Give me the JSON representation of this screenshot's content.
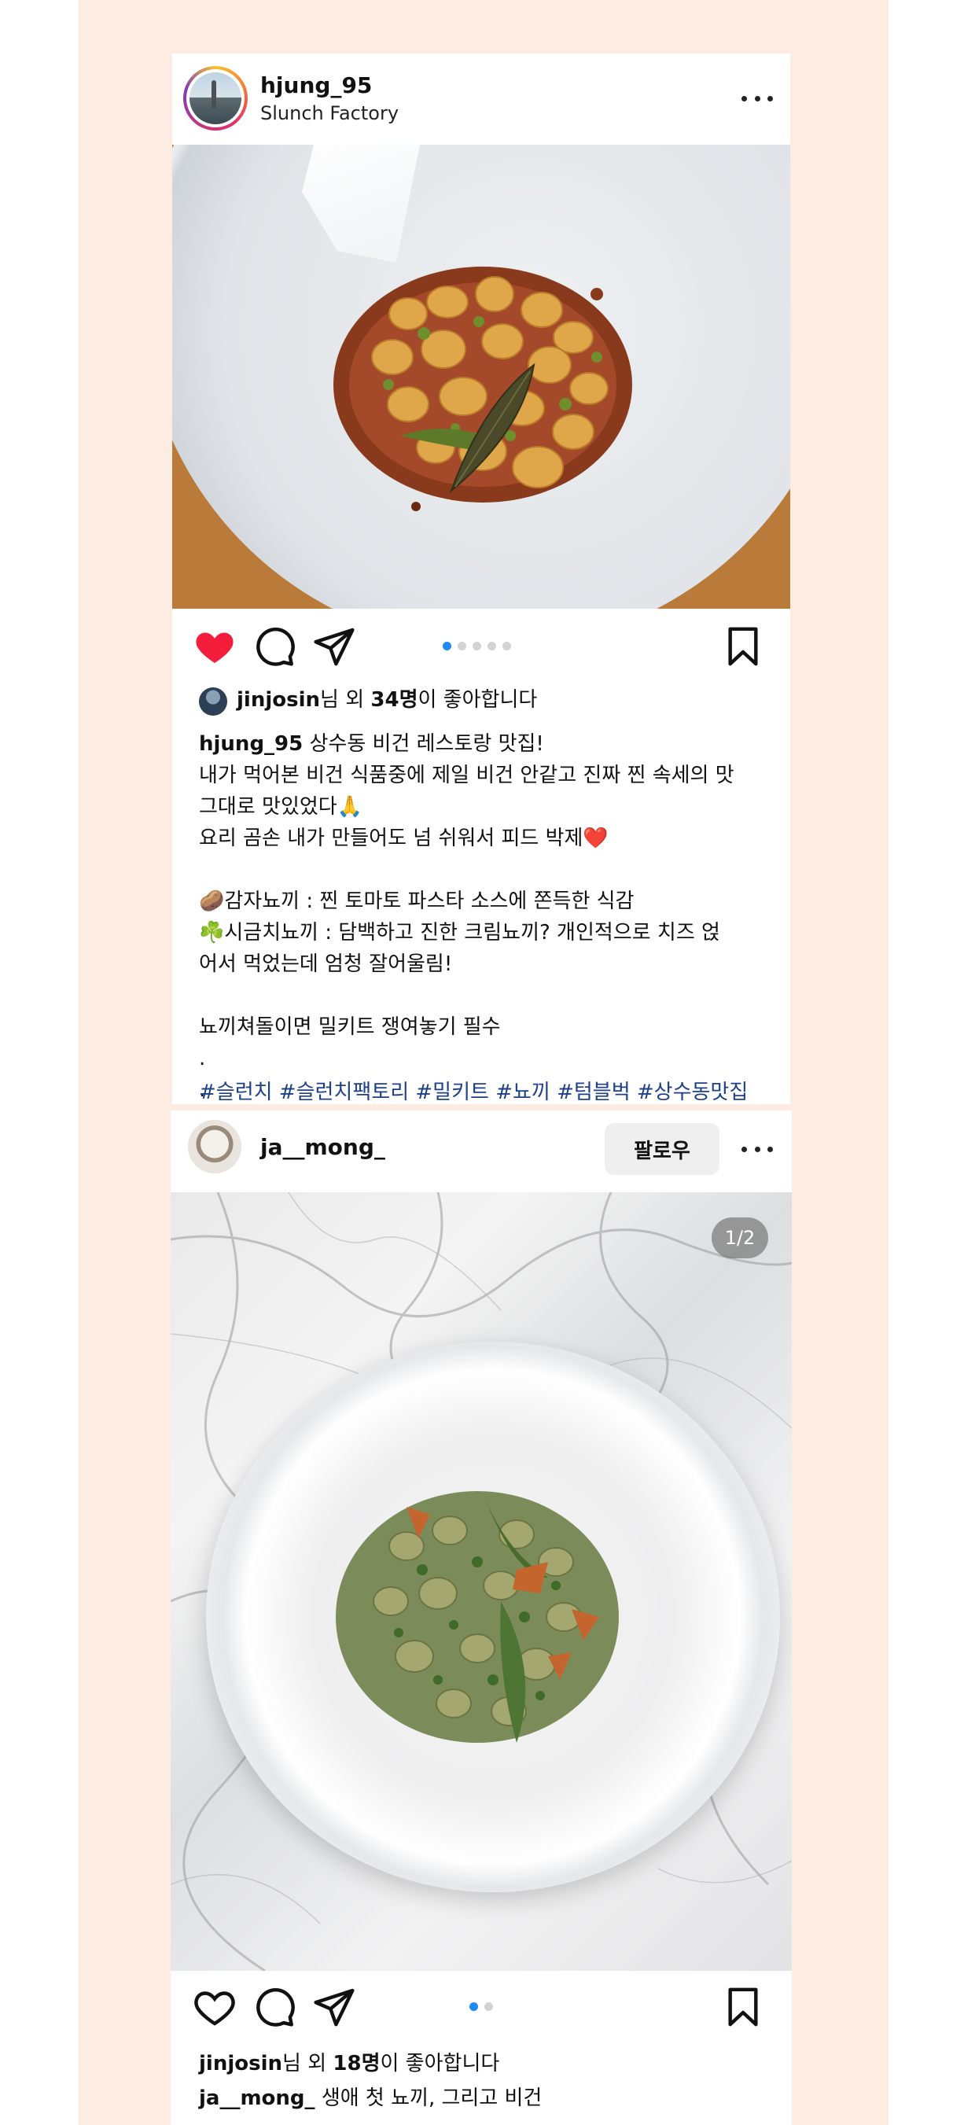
{
  "colors": {
    "page_background": "#fcece2",
    "heart_liked": "#f51d3c",
    "hashtag": "#1e3f8a",
    "dot_active": "#1e8bf0",
    "dot_inactive": "#d3d3d3",
    "follow_button_bg": "#efefef"
  },
  "icons": {
    "heart": "heart-icon",
    "comment": "comment-icon",
    "share": "paper-plane-icon",
    "bookmark": "bookmark-icon",
    "more": "more-dots-icon"
  },
  "post1": {
    "username": "hjung_95",
    "location": "Slunch Factory",
    "liked": true,
    "carousel": {
      "count": 5,
      "active": 1
    },
    "likes": {
      "user": "jinjosin",
      "middle": "님 외 ",
      "count": "34명",
      "suffix": "이 좋아합니다"
    },
    "caption": {
      "author": "hjung_95",
      "lines": [
        "상수동 비건 레스토랑 맛집!",
        "내가 먹어본 비건 식품중에 제일 비건 안같고 진짜 찐 속세의 맛",
        "그대로 맛있었다🙏",
        "요리 곰손 내가 만들어도 넘 쉬워서 피드 박제❤️",
        "",
        "🥔감자뇨끼 : 찐 토마토 파스타 소스에 쫀득한 식감",
        "☘️시금치뇨끼 : 담백하고 진한 크림뇨끼? 개인적으로 치즈 얹",
        "어서 먹었는데 엄청 잘어울림!",
        "",
        "뇨끼쳐돌이면 밀키트 쟁여놓기 필수",
        ".",
        "."
      ]
    },
    "hashtags": "#슬런치 #슬런치팩토리 #밀키트 #뇨끼 #텀블벅 #상수동맛집"
  },
  "post2": {
    "username": "ja__mong_",
    "follow_label": "팔로우",
    "counter": "1/2",
    "liked": false,
    "carousel": {
      "count": 2,
      "active": 1
    },
    "likes": {
      "user": "jinjosin",
      "middle": "님 외 ",
      "count": "18명",
      "suffix": "이 좋아합니다"
    },
    "caption": {
      "author": "ja__mong_",
      "text": "생애 첫 뇨끼, 그리고 비건"
    }
  }
}
